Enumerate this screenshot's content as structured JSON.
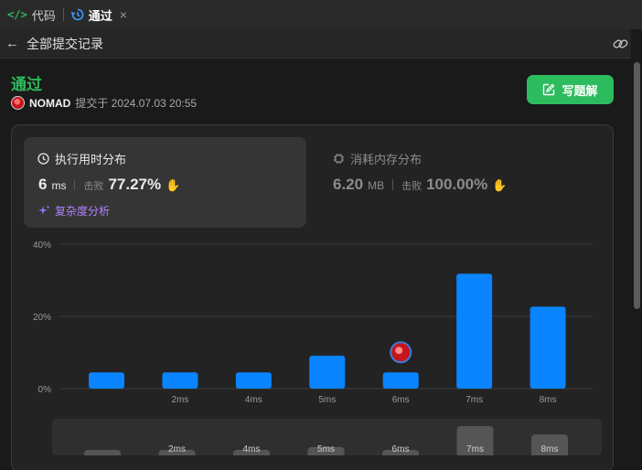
{
  "tabs": [
    {
      "label": "代码"
    },
    {
      "label": "通过",
      "close": "×"
    }
  ],
  "subheader": {
    "title": "全部提交记录"
  },
  "submission": {
    "status": "通过",
    "username": "NOMAD",
    "submitted_text": "提交于 2024.07.03 20:55"
  },
  "write_solution_label": "写题解",
  "runtime": {
    "title": "执行用时分布",
    "value": "6",
    "unit": "ms",
    "beats_label": "击败",
    "beats_value": "77.27%",
    "complexity_label": "复杂度分析"
  },
  "memory": {
    "title": "消耗内存分布",
    "value": "6.20",
    "unit": "MB",
    "beats_label": "击败",
    "beats_value": "100.00%"
  },
  "colors": {
    "accent_green": "#2cbb5d",
    "bar_blue": "#0a84ff",
    "purple": "#b183ff"
  },
  "chart_data": {
    "type": "bar",
    "categories": [
      "",
      "2ms",
      "4ms",
      "5ms",
      "6ms",
      "7ms",
      "8ms"
    ],
    "values": [
      4.5,
      4.5,
      4.5,
      9.1,
      4.5,
      31.8,
      22.7
    ],
    "yticks": [
      "40%",
      "20%",
      "0%"
    ],
    "ylim": [
      0,
      40
    ],
    "highlight_index": 4,
    "grid": true
  }
}
